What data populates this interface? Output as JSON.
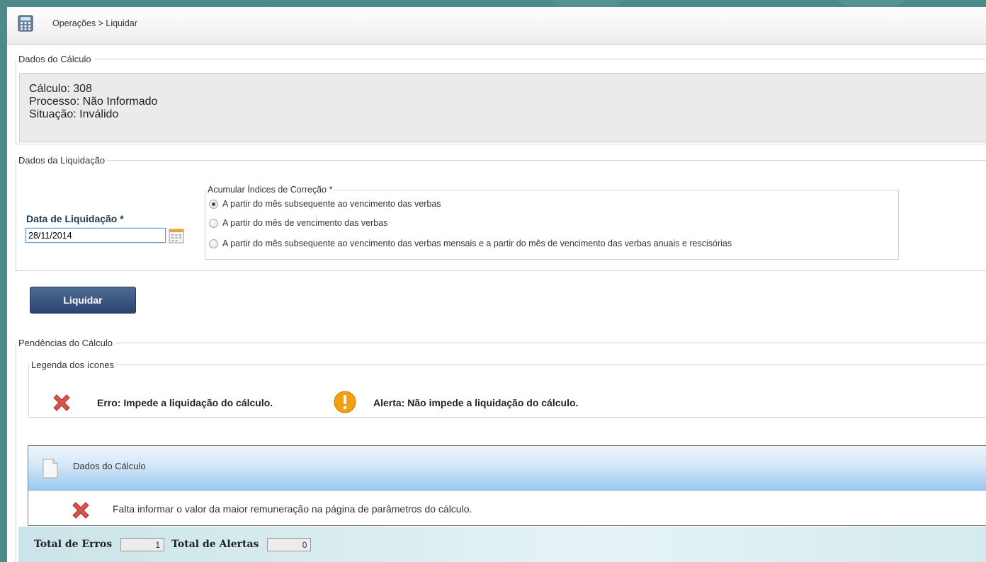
{
  "breadcrumb": "Operações > Liquidar",
  "dados_calculo": {
    "legend": "Dados do Cálculo",
    "calculo": "Cálculo: 308",
    "processo": "Processo: Não Informado",
    "situacao": "Situação: Inválido"
  },
  "dados_liquidacao": {
    "legend": "Dados da Liquidação",
    "data_label": "Data de Liquidação *",
    "data_value": "28/11/2014",
    "acumular_legend": "Acumular Índices de Correção *",
    "options": [
      {
        "label": "A partir do mês subsequente ao vencimento das verbas",
        "checked": true
      },
      {
        "label": "A partir do mês de vencimento das verbas",
        "checked": false
      },
      {
        "label": "A partir do mês subsequente ao vencimento das verbas mensais e a partir do mês de vencimento das verbas anuais e rescisórias",
        "checked": false
      }
    ]
  },
  "liquidar_button": "Liquidar",
  "pendencias": {
    "legend": "Pendências do Cálculo",
    "legenda_icones": "Legenda dos ícones",
    "erro_text": "Erro: Impede a liquidação do cálculo.",
    "alerta_text": "Alerta: Não impede a liquidação do cálculo.",
    "panel_title": "Dados do Cálculo",
    "pendencia_text": "Falta informar o valor da maior remuneração na página de parâmetros do cálculo."
  },
  "totals": {
    "erros_label": "Total de Erros",
    "erros_value": "1",
    "alertas_label": "Total de Alertas",
    "alertas_value": "0"
  },
  "colors": {
    "background": "#4d8a8a",
    "button": "#2a4570",
    "panel_header": "#9ac8ee",
    "error_icon": "#d9534f",
    "alert_icon": "#f0a010"
  }
}
